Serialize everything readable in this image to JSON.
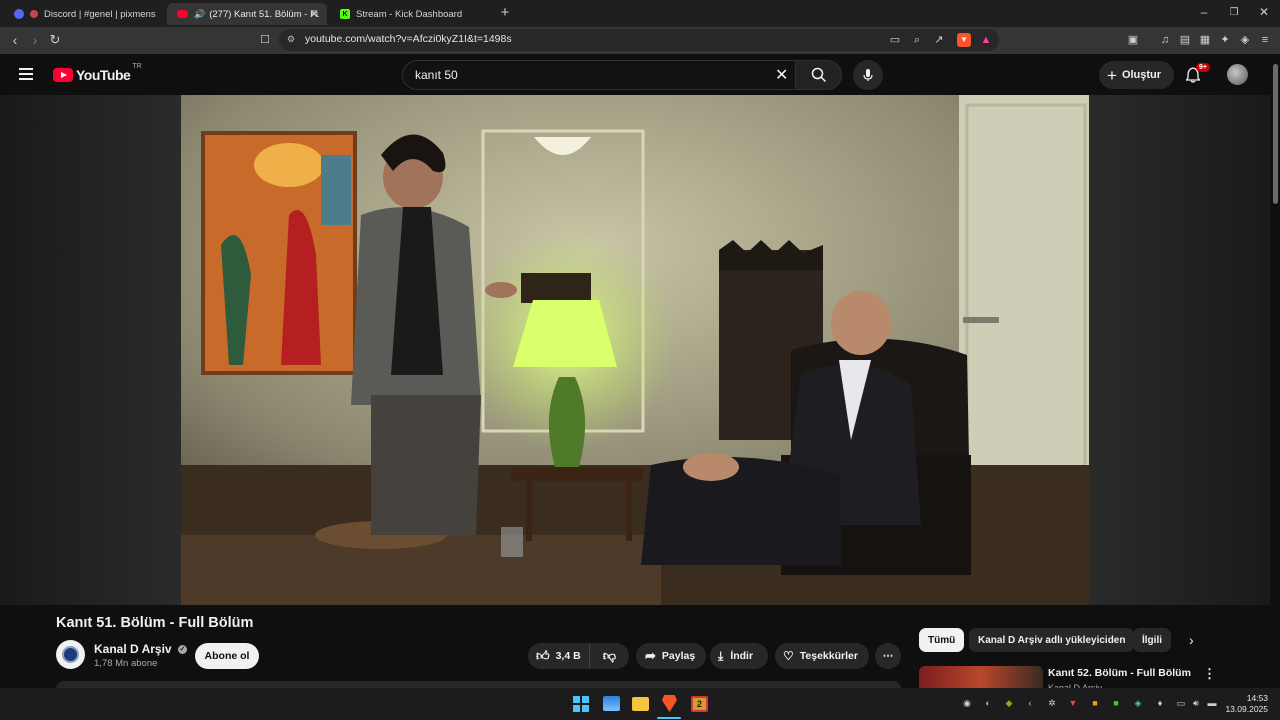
{
  "browser": {
    "tabs": [
      {
        "label": "Discord | #genel | pixmens"
      },
      {
        "label": "(277) Kanıt 51. Bölüm - Full Bö"
      },
      {
        "label": "Stream - Kick Dashboard"
      }
    ],
    "url": "youtube.com/watch?v=Afczi0kyZ1I&t=1498s"
  },
  "youtube": {
    "logo_text": "YouTube",
    "region": "TR",
    "search_value": "kanıt 50",
    "create_label": "Oluştur",
    "notifications_badge": "9+"
  },
  "video": {
    "title": "Kanıt 51. Bölüm - Full Bölüm",
    "channel_name": "Kanal D Arşiv",
    "subscribers": "1,78 Mn abone",
    "subscribe_label": "Abone ol",
    "likes": "3,4 B",
    "share_label": "Paylaş",
    "download_label": "İndir",
    "thanks_label": "Teşekkürler"
  },
  "chips": [
    "Tümü",
    "Kanal D Arşiv adlı yükleyiciden",
    "İlgili"
  ],
  "next_video": {
    "title": "Kanıt 52. Bölüm - Full Bölüm",
    "channel": "Kanal D Arşiv"
  },
  "taskbar": {
    "time": "14:53",
    "date": "13.09.2025"
  }
}
